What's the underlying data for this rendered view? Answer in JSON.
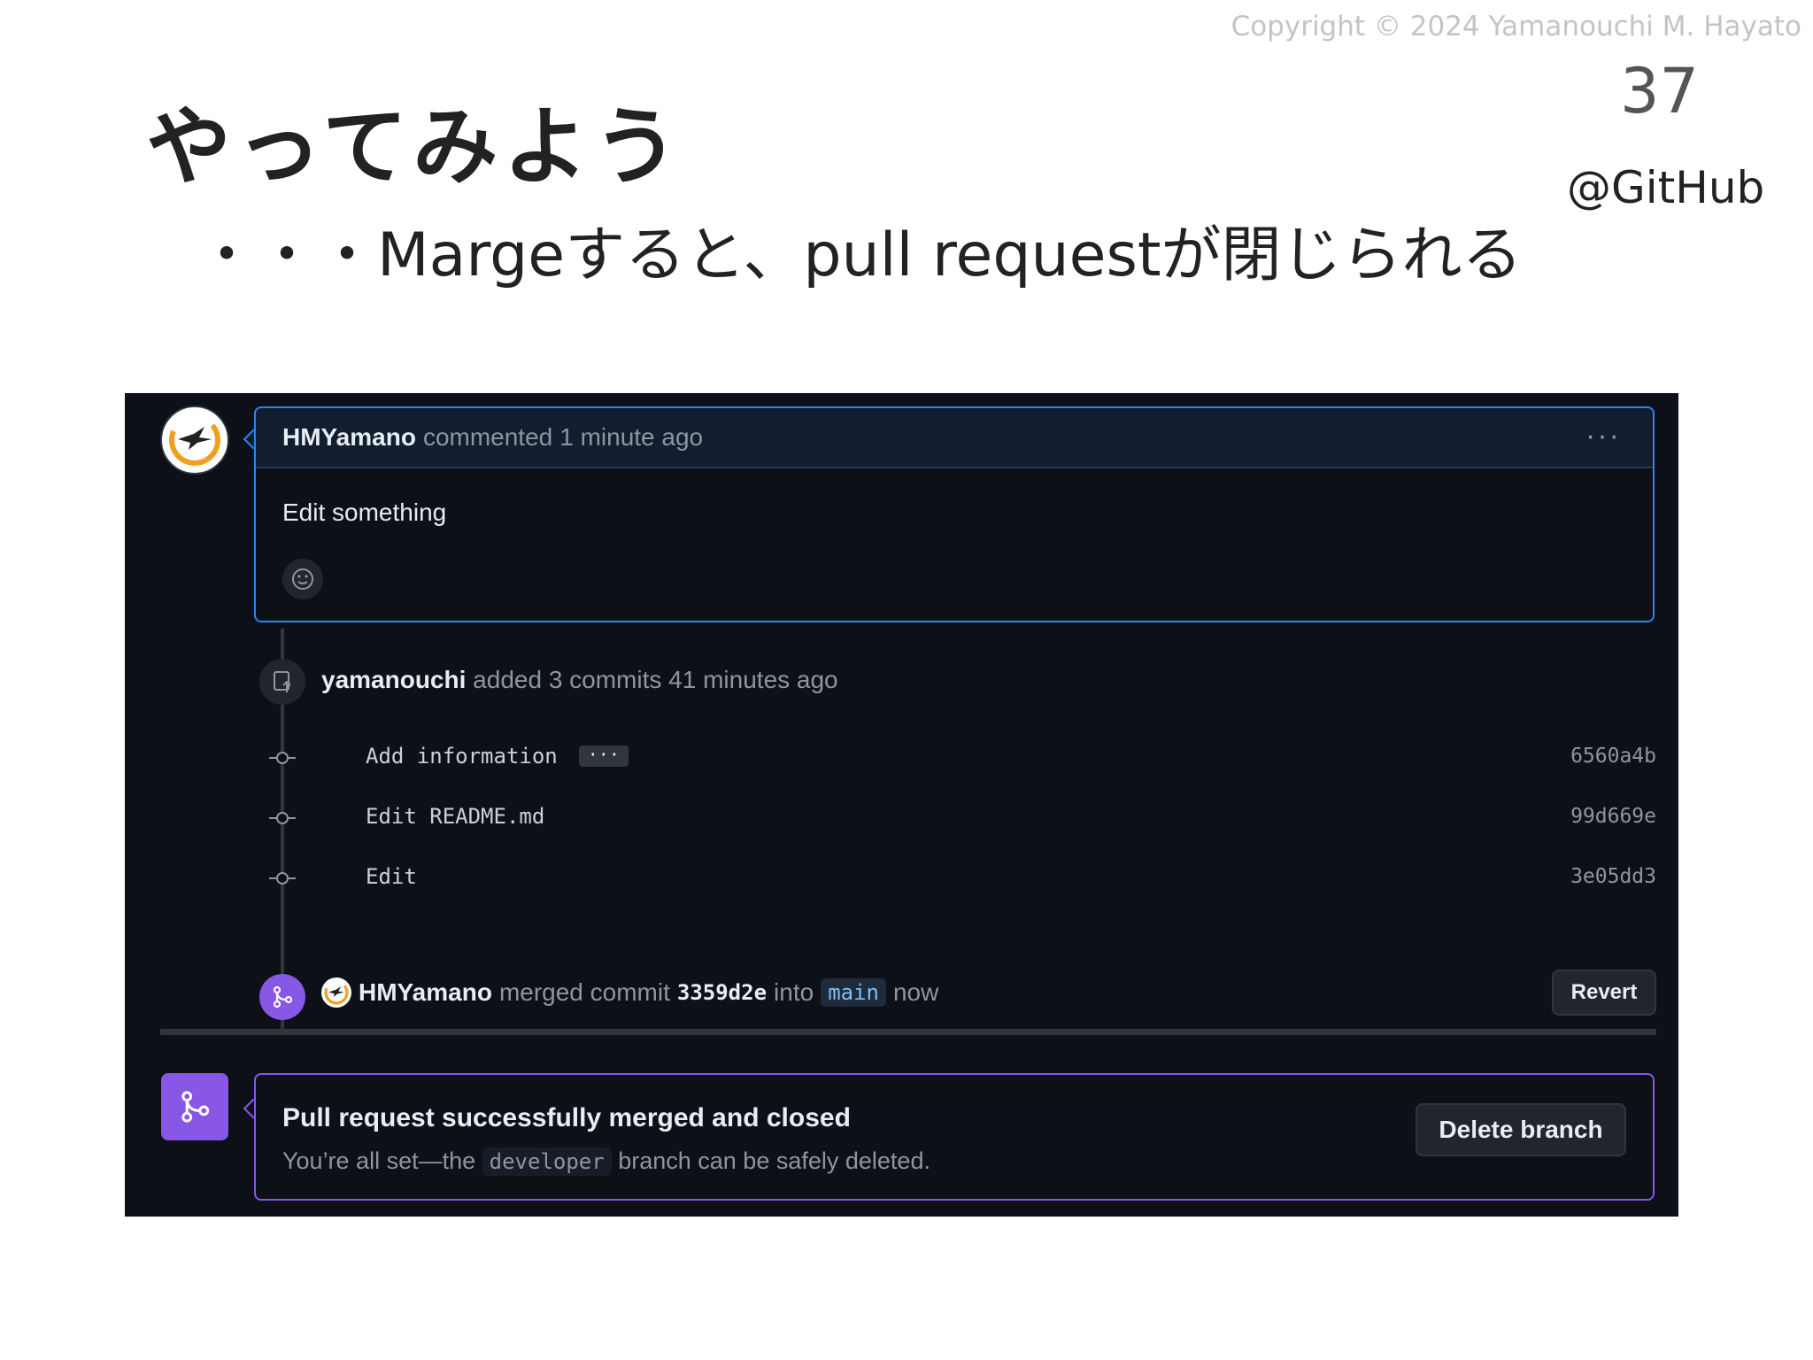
{
  "slide": {
    "copyright": "Copyright © 2024 Yamanouchi M. Hayato",
    "page_number": "37",
    "source_tag": "@GitHub",
    "title": "やってみよう",
    "subtitle": "・・・Margeすると、pull requestが閉じられる"
  },
  "comment": {
    "author": "HMYamano",
    "action": "commented",
    "time": "1 minute ago",
    "body": "Edit something"
  },
  "commits_event": {
    "author": "yamanouchi",
    "action": "added 3 commits",
    "time": "41 minutes ago",
    "commits": [
      {
        "message": "Add information",
        "sha": "6560a4b",
        "has_more": true,
        "more_label": "···"
      },
      {
        "message": "Edit README.md",
        "sha": "99d669e",
        "has_more": false
      },
      {
        "message": "Edit",
        "sha": "3e05dd3",
        "has_more": false
      }
    ]
  },
  "merge_event": {
    "author": "HMYamano",
    "action": "merged commit",
    "sha": "3359d2e",
    "into": "into",
    "branch": "main",
    "time": "now",
    "revert_label": "Revert"
  },
  "merged_box": {
    "title": "Pull request successfully merged and closed",
    "desc_prefix": "You’re all set—the",
    "branch": "developer",
    "desc_suffix": "branch can be safely deleted.",
    "delete_label": "Delete branch"
  },
  "colors": {
    "accent_blue": "#2f81f7",
    "merged_purple": "#8957e5",
    "background": "#0d1117"
  }
}
